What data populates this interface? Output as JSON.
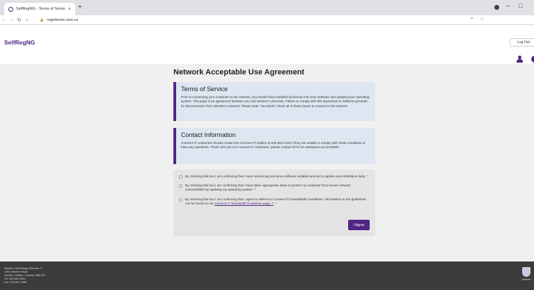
{
  "browser": {
    "tab_title": "SelfRegNG - Terms of Service",
    "tab_close": "×",
    "new_tab": "+",
    "url": "registerme.uwo.ca",
    "minimize": "–",
    "maximize": "□"
  },
  "header": {
    "brand": "SelfRegNG",
    "logout_label": "Log Out"
  },
  "main": {
    "title": "Network Acceptable Use Agreement",
    "tos": {
      "heading": "Terms of Service",
      "body": "Prior to connecting your computer to the network, you should have installed functional Anti-virus software and updated your operating system. This page is an agreement between you and Western University. Failure to comply with this agreement is sufficient grounds for disconnection from Western's network. Please Note: You MUST check all of these boxes to connect to the network"
    },
    "contact": {
      "heading": "Contact Information",
      "body": "Connect-IT customers should contact the Connect-IT Hotline at 519-661-4225 if they are unable to comply with these conditions or have any questions. Those who are not Connect-IT customers, please contact WTS for assistance at ext.83800."
    },
    "checkboxes": [
      {
        "text": "By checking this box I am confirming that I have functioning anti-virus software installed and set to update virus definitions daily. *"
      },
      {
        "text": "By checking this box I am confirming that I have taken appropriate steps to protect my computer from known network vulnerabilities by updating my operating system. *"
      },
      {
        "text": "By checking this box I am confirming that I agree to adhere to Connect-IT's Bandwidth Guidelines. Information on the guidelines can be found on our",
        "link": "Connect-IT Bandwidth Guidelines page ↗",
        "suffix": ". *"
      }
    ],
    "agree_label": "I Agree"
  },
  "footer": {
    "org": "Western Technology Services ↗",
    "address1": "1393 Western Road",
    "address2": "London, Ontario, Canada, N6A 3K7",
    "tel": "Tel: 519-661-3800",
    "fax": "Fax: 519-661-3486",
    "logo_word": "Western"
  },
  "colors": {
    "brand_purple": "#4f2683",
    "info_box_bg": "#dde6f1",
    "footer_bg": "#3b3b3b"
  }
}
